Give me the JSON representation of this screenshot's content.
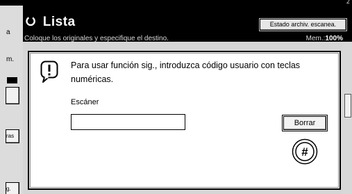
{
  "corner_indicator": "2",
  "left_panel": {
    "text_a": "a",
    "text_m": "m.",
    "btn_tras": "ras",
    "btn_g": "g."
  },
  "header": {
    "title": "Lista",
    "subtitle": "Coloque los originales y especifique el destino.",
    "estado_button": "Estado archiv. escanea.",
    "mem_label": "Mem.:",
    "mem_value": "100%"
  },
  "dialog": {
    "message": "Para usar función sig., introduzca código usuario con teclas numéricas.",
    "field_label": "Escáner",
    "field_value": "",
    "clear_button": "Borrar",
    "hash_key_label": "#"
  },
  "icons": {
    "info": "info-exclamation-icon",
    "title": "circle-icon",
    "hash": "hash-key-icon"
  }
}
